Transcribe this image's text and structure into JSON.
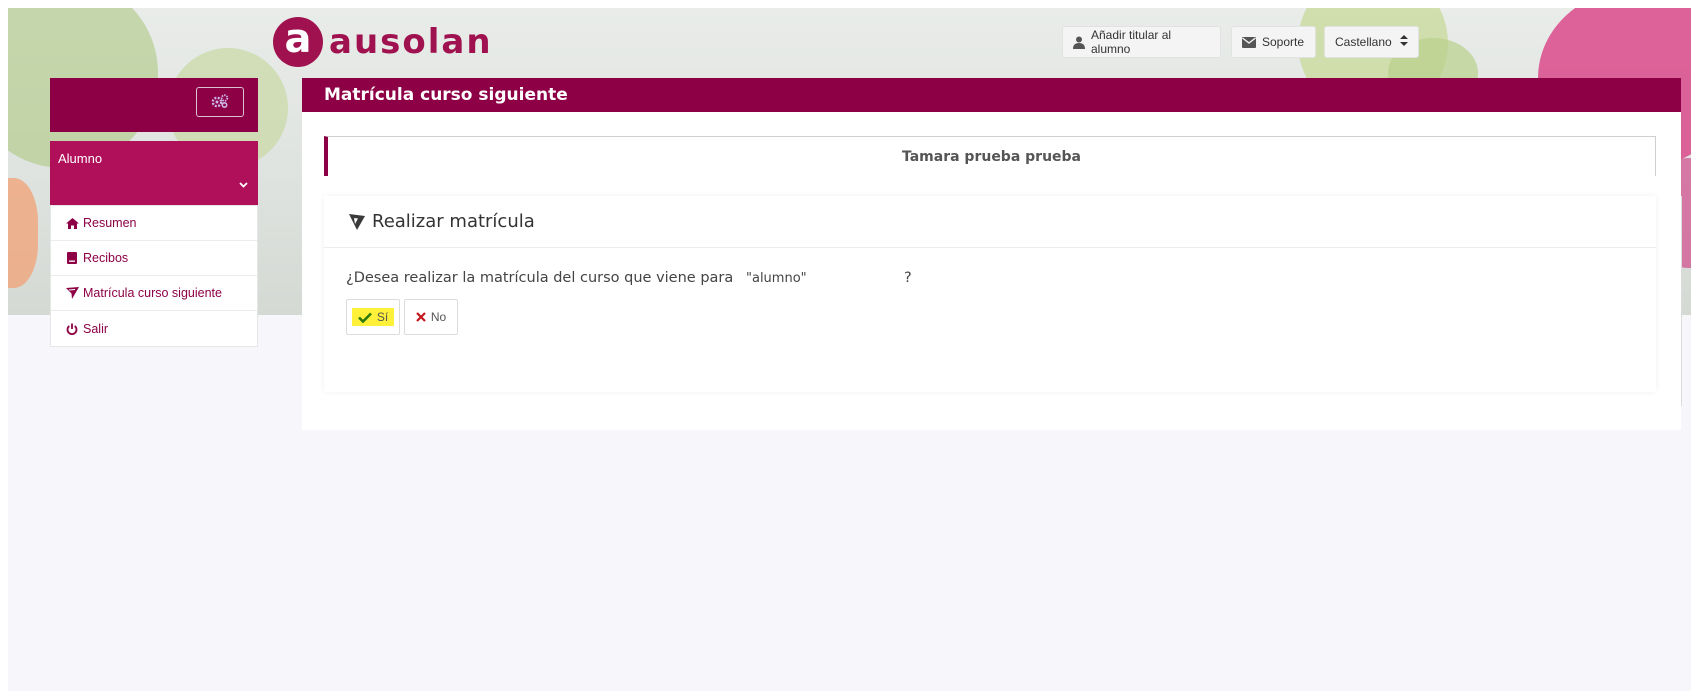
{
  "brand": {
    "logo_letter": "a",
    "logo_text": "ausolan",
    "color": "#a0124f"
  },
  "topbar": {
    "add_holder_label": "Añadir titular al alumno",
    "support_label": "Soporte",
    "language_label": "Castellano"
  },
  "sidebar": {
    "user_label": "Alumno",
    "items": [
      {
        "label": "Resumen",
        "icon": "home-icon"
      },
      {
        "label": "Recibos",
        "icon": "book-icon"
      },
      {
        "label": "Matrícula curso siguiente",
        "icon": "send-icon"
      },
      {
        "label": "Salir",
        "icon": "power-icon"
      }
    ]
  },
  "main": {
    "title": "Matrícula curso siguiente",
    "student_name": "Tamara prueba prueba",
    "card_title": "Realizar matrícula",
    "question": "¿Desea realizar la matrícula del curso que viene para",
    "student_ref": "\"alumno\"",
    "question_end": "?",
    "yes_label": "Sí",
    "no_label": "No"
  },
  "colors": {
    "primary": "#8d0046",
    "accent": "#b0105a",
    "highlight": "#fff03a"
  }
}
